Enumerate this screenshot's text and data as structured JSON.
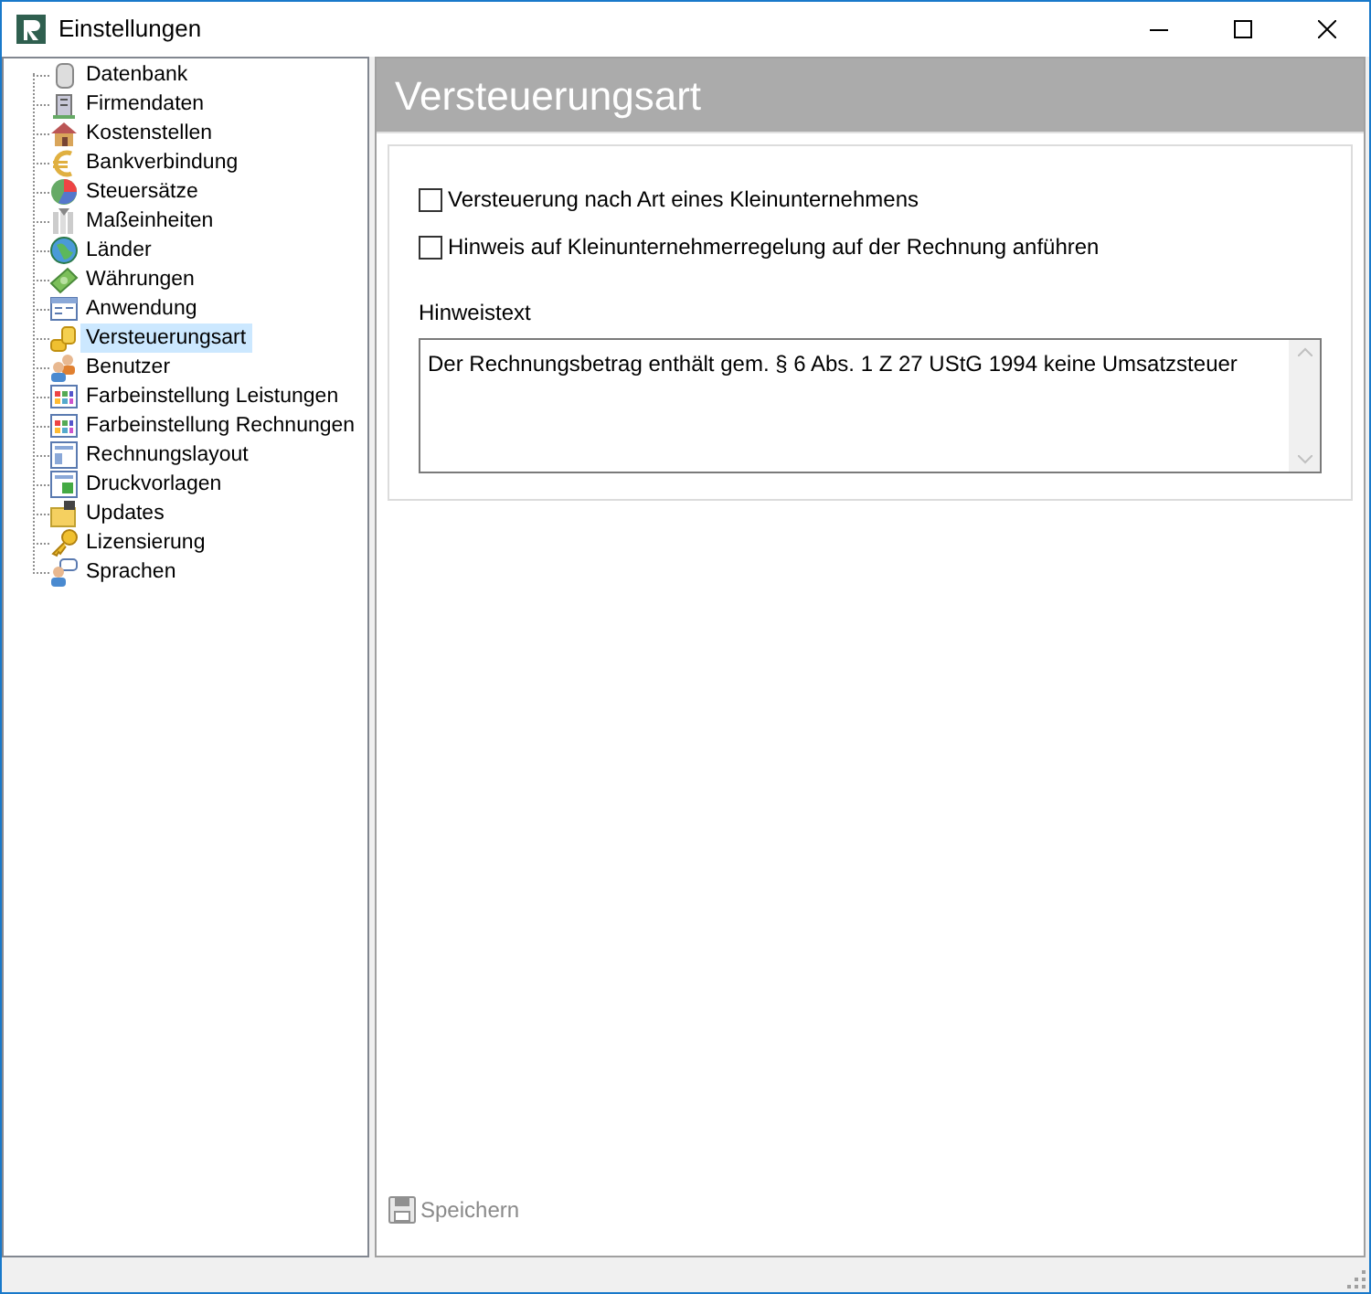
{
  "window": {
    "title": "Einstellungen"
  },
  "sidebar": {
    "items": [
      {
        "label": "Datenbank",
        "selected": false
      },
      {
        "label": "Firmendaten",
        "selected": false
      },
      {
        "label": "Kostenstellen",
        "selected": false
      },
      {
        "label": "Bankverbindung",
        "selected": false
      },
      {
        "label": "Steuersätze",
        "selected": false
      },
      {
        "label": "Maßeinheiten",
        "selected": false
      },
      {
        "label": "Länder",
        "selected": false
      },
      {
        "label": "Währungen",
        "selected": false
      },
      {
        "label": "Anwendung",
        "selected": false
      },
      {
        "label": "Versteuerungsart",
        "selected": true
      },
      {
        "label": "Benutzer",
        "selected": false
      },
      {
        "label": "Farbeinstellung Leistungen",
        "selected": false
      },
      {
        "label": "Farbeinstellung Rechnungen",
        "selected": false
      },
      {
        "label": "Rechnungslayout",
        "selected": false
      },
      {
        "label": "Druckvorlagen",
        "selected": false
      },
      {
        "label": "Updates",
        "selected": false
      },
      {
        "label": "Lizensierung",
        "selected": false
      },
      {
        "label": "Sprachen",
        "selected": false
      }
    ]
  },
  "panel": {
    "title": "Versteuerungsart",
    "checkboxes": [
      {
        "label": "Versteuerung nach Art eines Kleinunternehmens",
        "checked": false
      },
      {
        "label": "Hinweis auf Kleinunternehmerregelung auf der Rechnung anführen",
        "checked": false
      }
    ],
    "note_label": "Hinweistext",
    "note_value": "Der Rechnungsbetrag enthält gem. § 6 Abs. 1 Z 27 UStG 1994 keine Umsatzsteuer",
    "save_button": {
      "label": "Speichern",
      "disabled": true
    }
  }
}
